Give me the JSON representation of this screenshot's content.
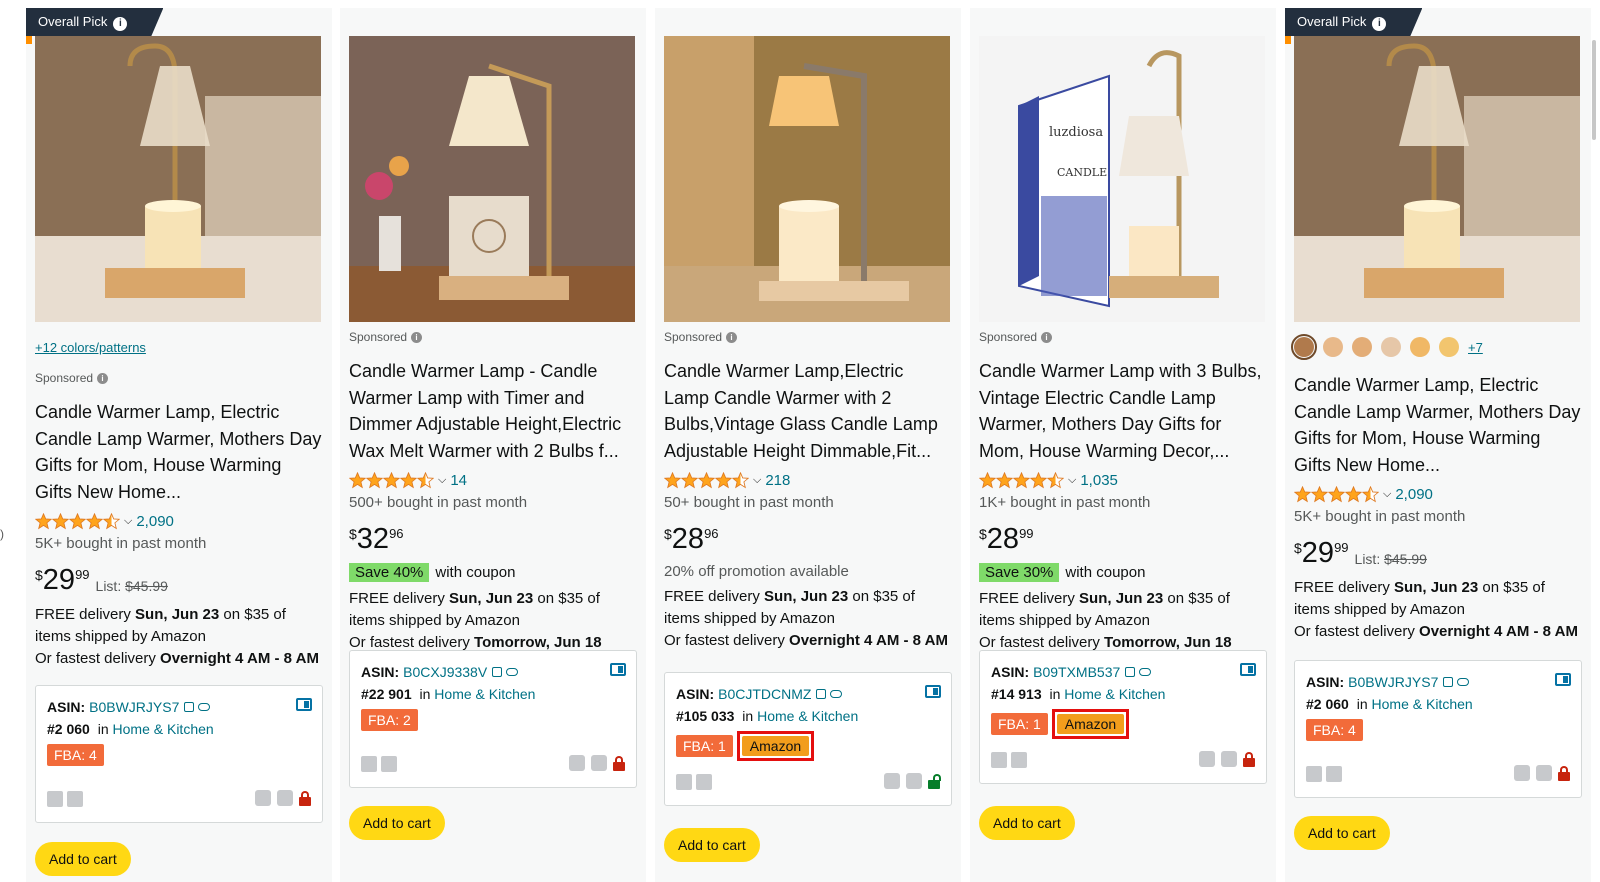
{
  "page": {
    "left_marker": ")"
  },
  "products": [
    {
      "badge": "Overall Pick",
      "colors_link": "+12 colors/patterns",
      "sponsored": "Sponsored",
      "title": "Candle Warmer Lamp, Electric Candle Lamp Warmer, Mothers Day Gifts for Mom, House Warming Gifts New Home...",
      "rating": 4.5,
      "rating_count": "2,090",
      "bought": "5K+ bought in past month",
      "price": {
        "symbol": "$",
        "whole": "29",
        "fraction": "99",
        "list_label": "List:",
        "list_price": "$45.99"
      },
      "delivery": {
        "prefix": "FREE delivery ",
        "date": "Sun, Jun 23",
        "suffix": " on $35 of items shipped by Amazon",
        "fast_prefix": "Or fastest delivery ",
        "fast": "Overnight 4 AM - 8 AM"
      },
      "asin": {
        "label": "ASIN:",
        "value": "B0BWJRJYS7",
        "rank": "#2 060",
        "in": "in",
        "category": "Home & Kitchen",
        "fba": "FBA: 4"
      },
      "cart": "Add to cart"
    },
    {
      "sponsored": "Sponsored",
      "title": "Candle Warmer Lamp - Candle Warmer Lamp with Timer and Dimmer Adjustable Height,Electric Wax Melt Warmer with 2 Bulbs f...",
      "rating": 4.5,
      "rating_count": "14",
      "bought": "500+ bought in past month",
      "price": {
        "symbol": "$",
        "whole": "32",
        "fraction": "96"
      },
      "coupon": {
        "save": "Save 40%",
        "text": "with coupon"
      },
      "delivery": {
        "prefix": "FREE delivery ",
        "date": "Sun, Jun 23",
        "suffix": " on $35 of items shipped by Amazon",
        "fast_prefix": "Or fastest delivery ",
        "fast": "Tomorrow, Jun 18"
      },
      "asin": {
        "label": "ASIN:",
        "value": "B0CXJ9338V",
        "rank": "#22 901",
        "in": "in",
        "category": "Home & Kitchen",
        "fba": "FBA: 2"
      },
      "cart": "Add to cart"
    },
    {
      "sponsored": "Sponsored",
      "title": "Candle Warmer Lamp,Electric Lamp Candle Warmer with 2 Bulbs,Vintage Glass Candle Lamp Adjustable Height Dimmable,Fit...",
      "rating": 4.5,
      "rating_count": "218",
      "bought": "50+ bought in past month",
      "price": {
        "symbol": "$",
        "whole": "28",
        "fraction": "96"
      },
      "promo": "20% off promotion available",
      "delivery": {
        "prefix": "FREE delivery ",
        "date": "Sun, Jun 23",
        "suffix": " on $35 of items shipped by Amazon",
        "fast_prefix": "Or fastest delivery ",
        "fast": "Overnight 4 AM - 8 AM"
      },
      "asin": {
        "label": "ASIN:",
        "value": "B0CJTDCNMZ",
        "rank": "#105 033",
        "in": "in",
        "category": "Home & Kitchen",
        "fba": "FBA: 1",
        "seller": "Amazon"
      },
      "cart": "Add to cart"
    },
    {
      "sponsored": "Sponsored",
      "title": "Candle Warmer Lamp with 3 Bulbs, Vintage Electric Candle Lamp Warmer, Mothers Day Gifts for Mom, House Warming Decor,...",
      "rating": 4.5,
      "rating_count": "1,035",
      "bought": "1K+ bought in past month",
      "price": {
        "symbol": "$",
        "whole": "28",
        "fraction": "99"
      },
      "coupon": {
        "save": "Save 30%",
        "text": "with coupon"
      },
      "delivery": {
        "prefix": "FREE delivery ",
        "date": "Sun, Jun 23",
        "suffix": " on $35 of items shipped by Amazon",
        "fast_prefix": "Or fastest delivery ",
        "fast": "Tomorrow, Jun 18"
      },
      "asin": {
        "label": "ASIN:",
        "value": "B09TXMB537",
        "rank": "#14 913",
        "in": "in",
        "category": "Home & Kitchen",
        "fba": "FBA: 1",
        "seller": "Amazon"
      },
      "image_text": {
        "brand": "luzdiosa",
        "product": "CANDLE"
      },
      "cart": "Add to cart"
    },
    {
      "badge": "Overall Pick",
      "swatches_more": "+7",
      "title": "Candle Warmer Lamp, Electric Candle Lamp Warmer, Mothers Day Gifts for Mom, House Warming Gifts New Home...",
      "rating": 4.5,
      "rating_count": "2,090",
      "bought": "5K+ bought in past month",
      "price": {
        "symbol": "$",
        "whole": "29",
        "fraction": "99",
        "list_label": "List:",
        "list_price": "$45.99"
      },
      "delivery": {
        "prefix": "FREE delivery ",
        "date": "Sun, Jun 23",
        "suffix": " on $35 of items shipped by Amazon",
        "fast_prefix": "Or fastest delivery ",
        "fast": "Overnight 4 AM - 8 AM"
      },
      "asin": {
        "label": "ASIN:",
        "value": "B0BWJRJYS7",
        "rank": "#2 060",
        "in": "in",
        "category": "Home & Kitchen",
        "fba": "FBA: 4"
      },
      "cart": "Add to cart"
    }
  ],
  "colors": {
    "link": "#007185",
    "star": "#ffa41c",
    "cart_button": "#ffd814",
    "fba_badge": "#f26b3a",
    "amazon_badge": "#f29d1c",
    "highlight_border": "#e40f0f",
    "save_badge": "#7fda69",
    "overall_pick_bg": "#232f3e"
  },
  "swatch_colors": [
    "#b07a4c",
    "#e8b98a",
    "#e3ad77",
    "#e6c7a8",
    "#f0b866",
    "#f2c56e"
  ]
}
